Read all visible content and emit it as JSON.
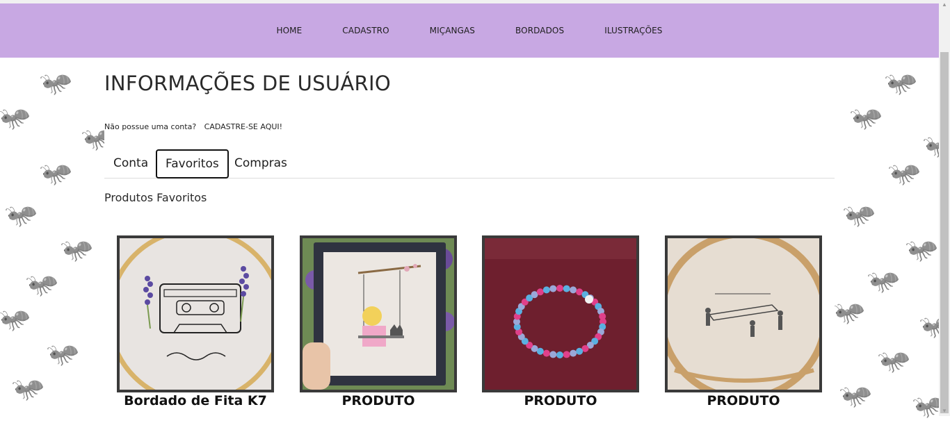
{
  "nav": {
    "items": [
      "HOME",
      "CADASTRO",
      "MIÇANGAS",
      "BORDADOS",
      "ILUSTRAÇÕES"
    ]
  },
  "page": {
    "title": "INFORMAÇÕES DE USUÁRIO",
    "account_prompt": "Não possue uma conta?",
    "signup_link": "CADASTRE-SE AQUI!"
  },
  "tabs": [
    {
      "label": "Conta",
      "active": false
    },
    {
      "label": "Favoritos",
      "active": true
    },
    {
      "label": "Compras",
      "active": false
    }
  ],
  "favorites": {
    "title": "Produtos Favoritos",
    "products": [
      {
        "name": "Bordado de Fita K7"
      },
      {
        "name": "PRODUTO"
      },
      {
        "name": "PRODUTO"
      },
      {
        "name": "PRODUTO"
      }
    ]
  },
  "colors": {
    "navbar": "#c8a8e3",
    "frame": "#3a3a3a"
  }
}
